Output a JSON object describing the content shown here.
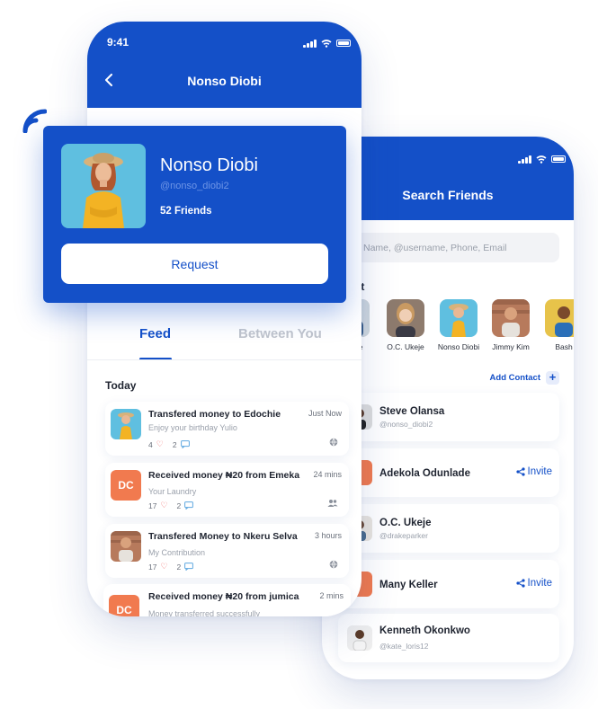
{
  "colors": {
    "brand": "#1450c8",
    "accent_orange": "#f17a4f",
    "heart": "#ef5a5a"
  },
  "profile_screen": {
    "status_time": "9:41",
    "title": "Nonso Diobi",
    "tabs": [
      "Feed",
      "Between You"
    ],
    "section_label": "Today",
    "feed": [
      {
        "title": "Transfered money to Edochie",
        "subtitle": "Enjoy your birthday Yulio",
        "time": "Just Now",
        "likes": "4",
        "comments": "2",
        "avatar": "photo-woman",
        "privacy_icon": "globe-icon"
      },
      {
        "title": "Received money ₦20 from Emeka",
        "subtitle": "Your Laundry",
        "time": "24 mins",
        "likes": "17",
        "comments": "2",
        "avatar_initials": "DC",
        "privacy_icon": "friends-icon"
      },
      {
        "title": "Transfered Money to Nkeru Selva",
        "subtitle": "My Contribution",
        "time": "3 hours",
        "likes": "17",
        "comments": "2",
        "avatar": "photo-man",
        "privacy_icon": "globe-icon"
      },
      {
        "title": "Received money ₦20 from jumica",
        "subtitle": "Money transferred successfully",
        "time": "2 mins",
        "avatar_initials": "DC"
      }
    ]
  },
  "profile_card": {
    "name": "Nonso Diobi",
    "handle": "@nonso_diobi2",
    "friends": "52 Friends",
    "request_label": "Request"
  },
  "search_screen": {
    "title": "Search Friends",
    "search_placeholder": "Name, @username, Phone, Email",
    "recent_label": "nt",
    "recent": [
      "la Mike",
      "O.C. Ukeje",
      "Nonso Diobi",
      "Jimmy Kim",
      "Bash"
    ],
    "add_contact_label": "Add Contact",
    "contacts": [
      {
        "name": "Steve Olansa",
        "handle": "@nonso_diobi2"
      },
      {
        "name": "Adekola Odunlade",
        "invite_label": "Invite"
      },
      {
        "name": "O.C. Ukeje",
        "handle": "@drakeparker"
      },
      {
        "name": "Many Keller",
        "invite_label": "Invite"
      },
      {
        "name": "Kenneth Okonkwo",
        "handle": "@kate_loris12"
      }
    ]
  }
}
